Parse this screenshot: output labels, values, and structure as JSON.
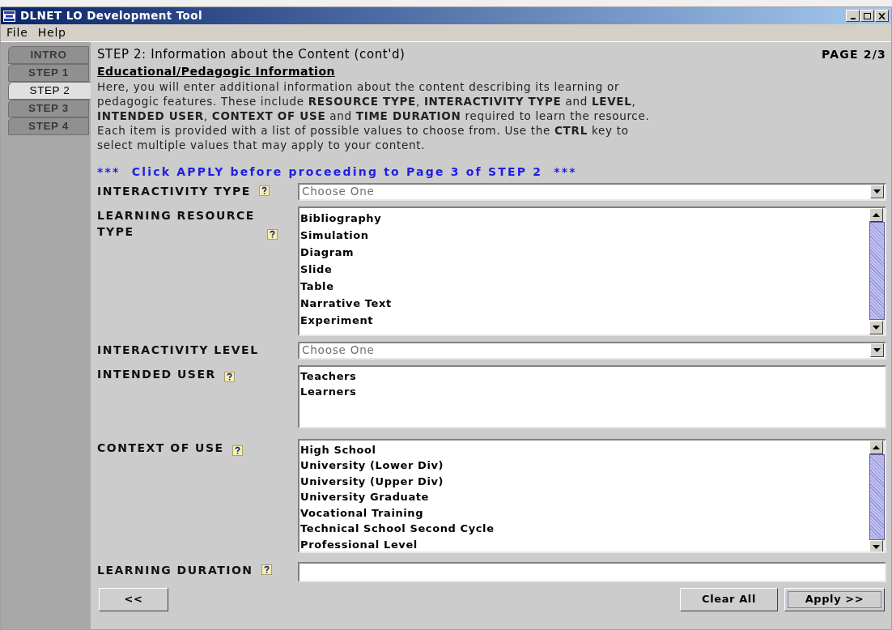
{
  "window": {
    "title": "DLNET LO Development Tool"
  },
  "menu": [
    "File",
    "Help"
  ],
  "tabs": [
    {
      "label": "INTRO",
      "selected": false
    },
    {
      "label": "STEP 1",
      "selected": false
    },
    {
      "label": "STEP 2",
      "selected": true
    },
    {
      "label": "STEP 3",
      "selected": false
    },
    {
      "label": "STEP 4",
      "selected": false
    }
  ],
  "header": {
    "title": "STEP 2: Information about the Content (cont'd)",
    "page": "PAGE 2/3"
  },
  "section": {
    "heading": "Educational/Pedagogic Information",
    "text": "Here, you will enter additional information about the content describing its learning or pedagogic features. These include **RESOURCE TYPE**, **INTERACTIVITY TYPE** and **LEVEL**, **INTENDED USER**, **CONTEXT OF USE** and **TIME DURATION** required to learn the resource. Each item is provided with a list of possible values to choose from. Use the **CTRL** key to select multiple values that may apply to your content.",
    "notice": "***  Click APPLY before proceeding to Page 3 of STEP 2  ***"
  },
  "fields": [
    {
      "kind": "dropdown",
      "label": "INTERACTIVITY TYPE",
      "help": true,
      "placeholder": "Choose One"
    },
    {
      "kind": "list",
      "label": "LEARNING RESOURCE TYPE",
      "help": true,
      "items": [
        "Bibliography",
        "Simulation",
        "Diagram",
        "Slide",
        "Table",
        "Narrative Text",
        "Experiment"
      ]
    },
    {
      "kind": "dropdown",
      "label": "INTERACTIVITY LEVEL",
      "help": false,
      "placeholder": "Choose One"
    },
    {
      "kind": "list",
      "label": "INTENDED USER",
      "help": true,
      "items": [
        "Teachers",
        "Learners"
      ]
    },
    {
      "kind": "list",
      "label": "CONTEXT OF USE",
      "help": true,
      "items": [
        "High School",
        "University (Lower Div)",
        "University (Upper Div)",
        "University Graduate",
        "Vocational Training",
        "Technical School Second Cycle",
        "Professional Level"
      ]
    },
    {
      "kind": "text",
      "label": "LEARNING DURATION",
      "help": true
    }
  ],
  "buttons": [
    {
      "label": "<<",
      "focused": false
    },
    {
      "label": "Clear All",
      "focused": false
    },
    {
      "label": "Apply >>",
      "focused": true
    }
  ]
}
